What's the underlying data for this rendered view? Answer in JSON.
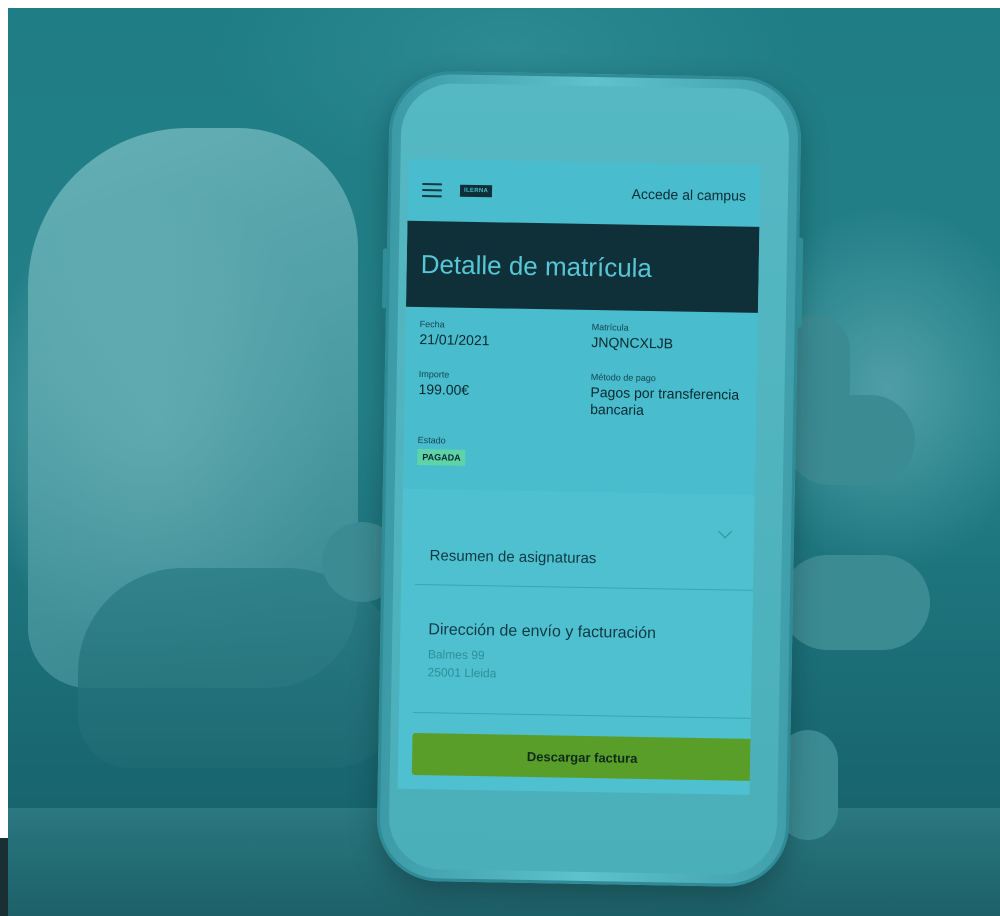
{
  "header": {
    "logo_text": "ILERNA",
    "campus_link": "Accede al campus"
  },
  "title": "Detalle de matrícula",
  "details": {
    "fecha": {
      "label": "Fecha",
      "value": "21/01/2021"
    },
    "matricula": {
      "label": "Matrícula",
      "value": "JNQNCXLJB"
    },
    "importe": {
      "label": "Importe",
      "value": "199.00€"
    },
    "metodo": {
      "label": "Método de pago",
      "value": "Pagos por transferencia bancaria"
    },
    "estado": {
      "label": "Estado",
      "value": "PAGADA"
    }
  },
  "summary": {
    "label": "Resumen de asignaturas"
  },
  "address": {
    "title": "Dirección de envío y facturación",
    "line1": "Balmes 99",
    "line2": "25001 Lleida"
  },
  "download_label": "Descargar factura",
  "colors": {
    "title_bar": "#0f3038",
    "screen": "#49bccd",
    "status_badge": "#5fd3a8",
    "download_button": "#5a9e2a"
  }
}
